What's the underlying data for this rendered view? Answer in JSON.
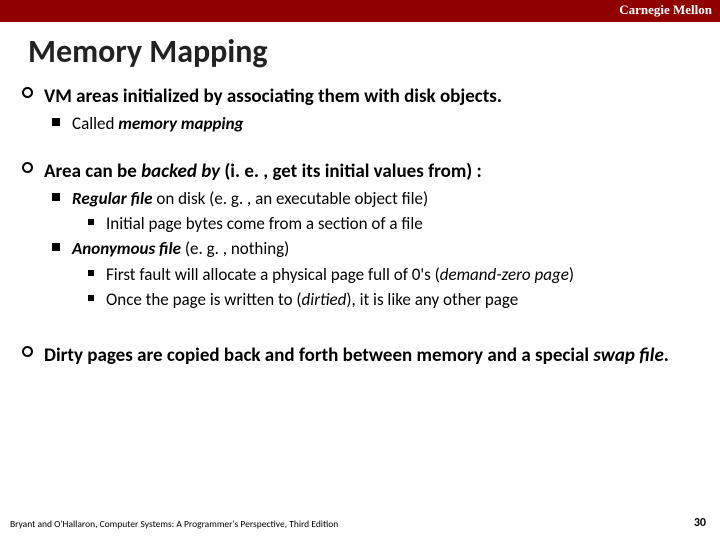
{
  "header": {
    "brand": "Carnegie Mellon"
  },
  "title": "Memory Mapping",
  "bullets": {
    "a": {
      "text": "VM areas initialized by associating them with disk objects.",
      "sub1_pre": "Called ",
      "sub1_em": "memory mapping"
    },
    "b": {
      "pre": "Area can be ",
      "em": "backed by",
      "post": " (i. e. , get its initial values from) :",
      "r": {
        "em": "Regular file",
        "post": " on disk (e. g. , an executable object file)",
        "sub": "Initial page bytes come from a section of a file"
      },
      "an": {
        "em": "Anonymous file",
        "post": " (e. g. , nothing)",
        "s1_pre": "First fault will allocate a physical page full of 0's (",
        "s1_em": "demand-zero page",
        "s1_post": ")",
        "s2_pre": "Once the page is written to (",
        "s2_em": "dirtied",
        "s2_post": "), it is like any other page"
      }
    },
    "c": {
      "pre": "Dirty pages are copied back and forth between memory and a special ",
      "em": "swap file",
      "post": "."
    }
  },
  "footer": "Bryant and O'Hallaron, Computer Systems: A Programmer's Perspective, Third Edition",
  "page": "30"
}
